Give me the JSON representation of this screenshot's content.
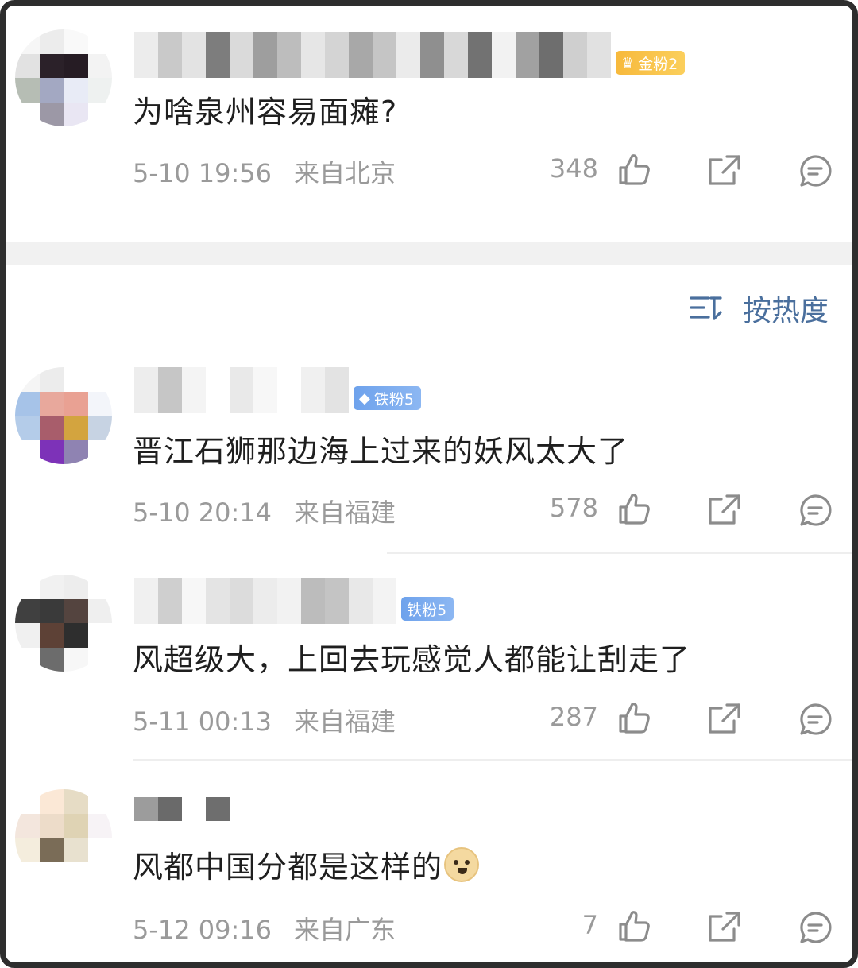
{
  "comments": [
    {
      "badge": "金粉2",
      "text": "为啥泉州容易面瘫?",
      "time": "5-10 19:56",
      "location": "来自北京",
      "likes": "348"
    },
    {
      "badge": "铁粉5",
      "text": "晋江石狮那边海上过来的妖风太大了",
      "time": "5-10 20:14",
      "location": "来自福建",
      "likes": "578"
    },
    {
      "badge": "铁粉5",
      "text": "风超级大，上回去玩感觉人都能让刮走了",
      "time": "5-11 00:13",
      "location": "来自福建",
      "likes": "287"
    },
    {
      "text": "风都中国分都是这样的",
      "time": "5-12 09:16",
      "location": "来自广东",
      "likes": "7"
    }
  ],
  "sort": {
    "label": "按热度",
    "icon": "sort-icon"
  },
  "icons": {
    "like": "thumbs-up-icon",
    "share": "share-icon",
    "reply": "comment-icon",
    "emoji": "doge-emoji"
  },
  "colors": {
    "link_blue": "#4a6f9d",
    "meta_gray": "#9a9a9a",
    "gold_badge": "#f7b93c",
    "iron_badge": "#6ea2ec"
  }
}
